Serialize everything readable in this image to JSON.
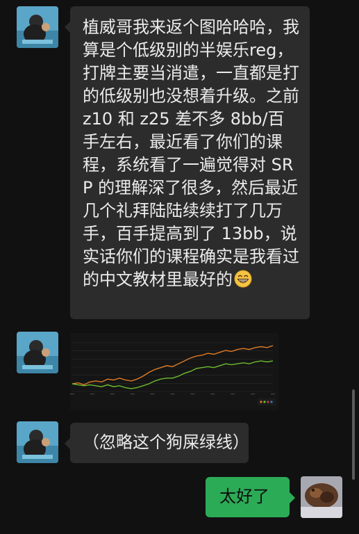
{
  "messages": [
    {
      "sender": "other",
      "type": "text",
      "text": "植威哥我来返个图哈哈哈，我算是个低级别的半娱乐reg，打牌主要当消遣，一直都是打的低级别也没想着升级。之前 z10 和 z25 差不多 8bb/百手左右，最近看了你们的课程，系统看了一遍觉得对 SRP 的理解深了很多，然后最近几个礼拜陆陆续续打了几万手，百手提高到了 13bb，说实话你们的课程确实是我看过的中文教材里最好的",
      "emoji": "grinning-face-emoji"
    },
    {
      "sender": "other",
      "type": "image",
      "chart_data": {
        "type": "line",
        "series": [
          {
            "color": "#e07b26",
            "values": [
              0,
              1,
              -1,
              2,
              3,
              2,
              5,
              4,
              6,
              4,
              3,
              5,
              8,
              12,
              15,
              17,
              19,
              18,
              21,
              24,
              27,
              29,
              30,
              32,
              31,
              33,
              35,
              34,
              36,
              37,
              36,
              38,
              39,
              38,
              40
            ]
          },
          {
            "color": "#6fbd2f",
            "values": [
              0,
              -1,
              -2,
              -1,
              -2,
              -3,
              -1,
              -3,
              -2,
              -4,
              -5,
              -4,
              -2,
              0,
              3,
              5,
              6,
              6,
              8,
              11,
              13,
              16,
              17,
              18,
              17,
              19,
              21,
              20,
              21,
              22,
              21,
              23,
              24,
              23,
              24
            ]
          }
        ],
        "grid": true,
        "legend": "bottom-right"
      }
    },
    {
      "sender": "other",
      "type": "text",
      "text": "（忽略这个狗屎绿线）"
    },
    {
      "sender": "me",
      "type": "text",
      "text": "太好了"
    }
  ],
  "colors": {
    "background": "#111111",
    "incoming_bubble": "#2c2c2c",
    "outgoing_bubble": "#2cab57",
    "incoming_text": "#ebebeb"
  },
  "icons": {
    "scroll": "scrollbar-thumb"
  }
}
